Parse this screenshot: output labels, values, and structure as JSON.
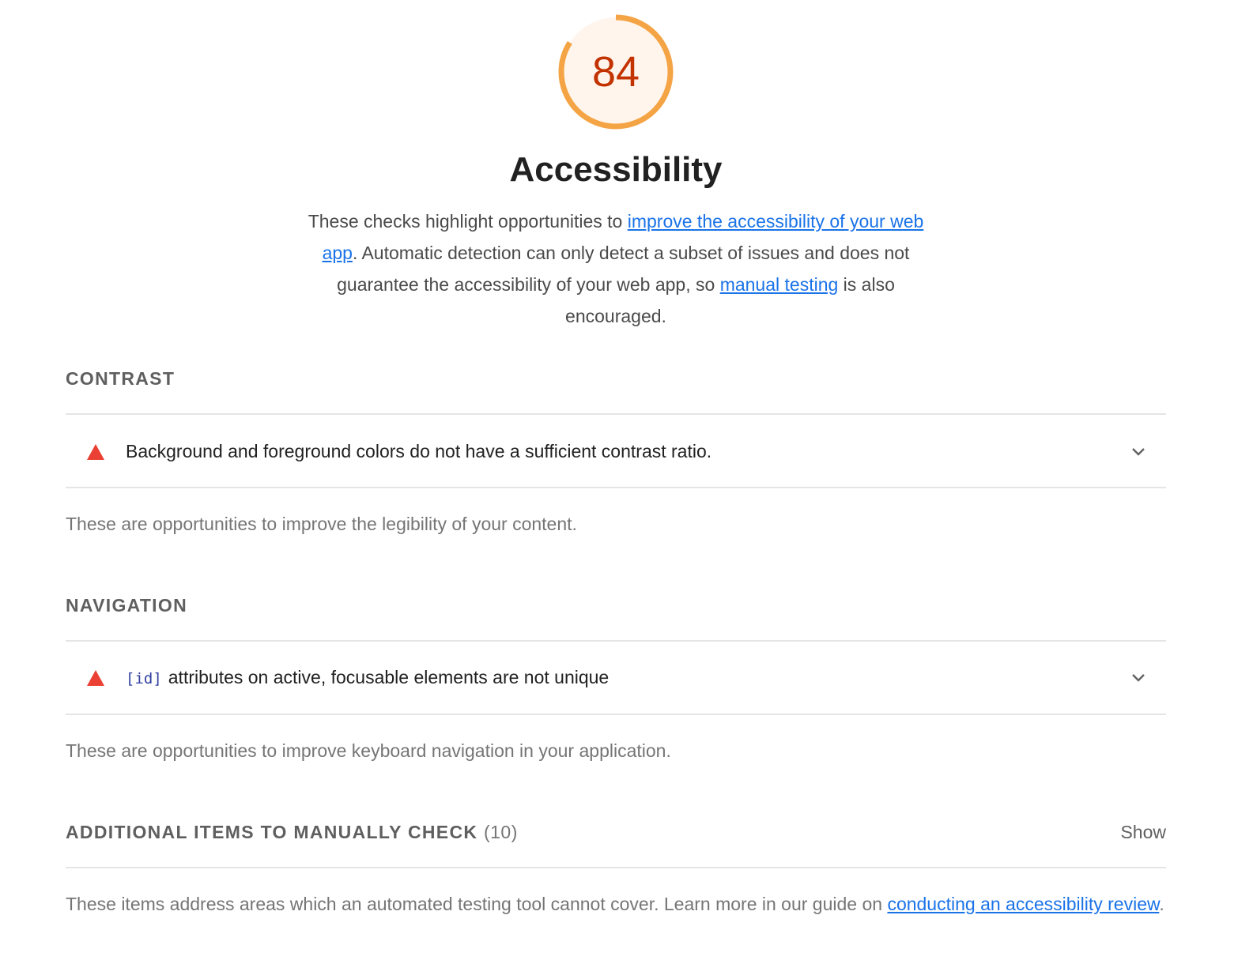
{
  "score": {
    "value": "84",
    "fraction": 0.84,
    "color": "#f4a444",
    "background": "#fff5ec",
    "text_color": "#c33300"
  },
  "header": {
    "title": "Accessibility",
    "description": {
      "text1": "These checks highlight opportunities to ",
      "link1": "improve the accessibility of your web app",
      "text2": ". Automatic detection can only detect a subset of issues and does not guarantee the accessibility of your web app, so ",
      "link2": "manual testing",
      "text3": " is also encouraged."
    }
  },
  "sections": {
    "contrast": {
      "title": "Contrast",
      "audit": {
        "icon": "warning-triangle-icon",
        "text": "Background and foreground colors do not have a sufficient contrast ratio."
      },
      "description": "These are opportunities to improve the legibility of your content."
    },
    "navigation": {
      "title": "Navigation",
      "audit": {
        "icon": "warning-triangle-icon",
        "code": "[id]",
        "text": "attributes on active, focusable elements are not unique"
      },
      "description": "These are opportunities to improve keyboard navigation in your application."
    },
    "manual": {
      "title": "Additional items to manually check",
      "count": "(10)",
      "toggle": "Show",
      "description_text": "These items address areas which an automated testing tool cannot cover. Learn more in our guide on ",
      "description_link": "conducting an accessibility review",
      "description_end": "."
    }
  },
  "colors": {
    "fail_red": "#eb4034",
    "link_blue": "#1a73e8",
    "code_blue": "#303f9f"
  }
}
